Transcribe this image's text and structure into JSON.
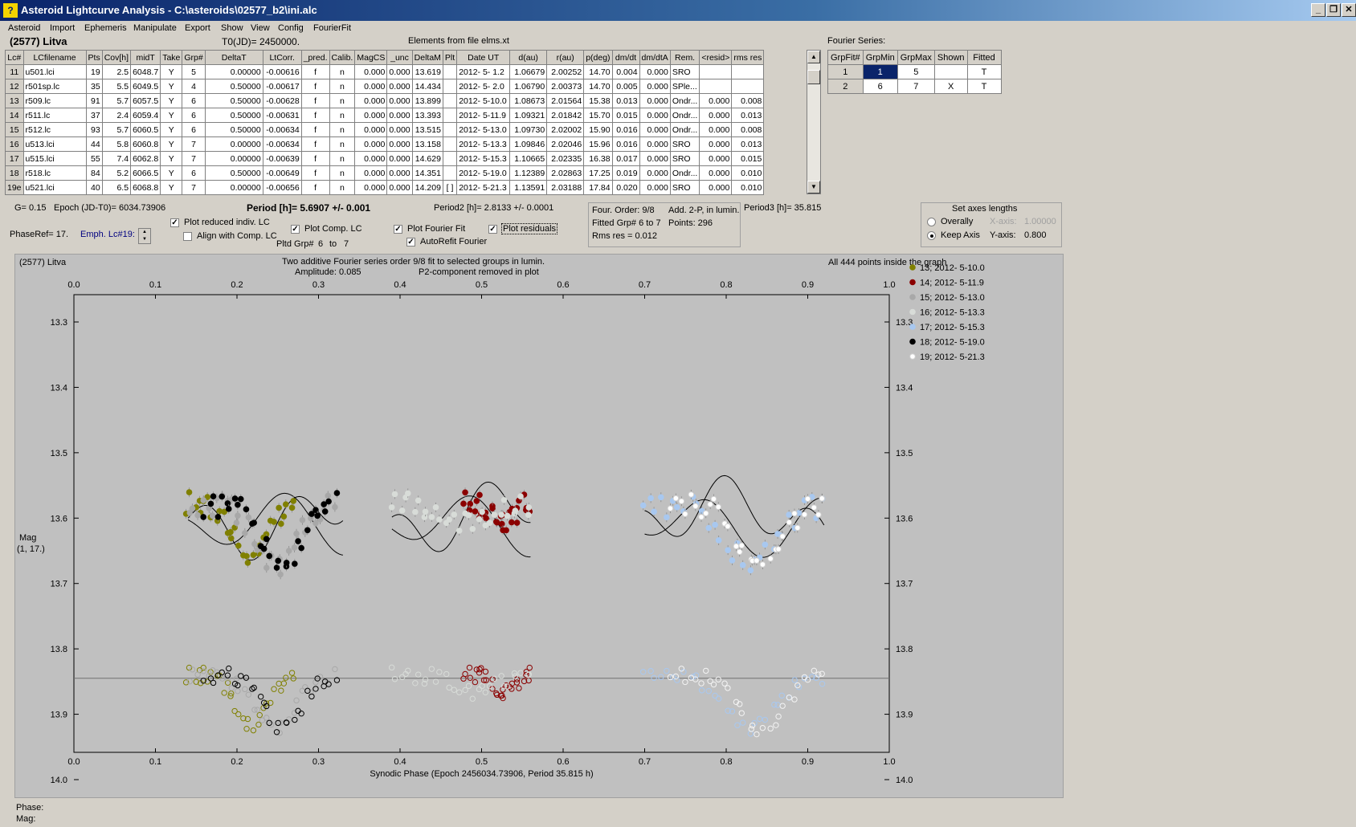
{
  "window": {
    "title": "Asteroid Lightcurve Analysis - C:\\asteroids\\02577_b2\\ini.alc",
    "app_icon": "app-icon"
  },
  "menu": [
    "Asteroid",
    "Import",
    "Ephemeris",
    "Manipulate",
    "Export",
    "Show",
    "View",
    "Config",
    "FourierFit"
  ],
  "header": {
    "asteroid": "(2577) Litva",
    "t0": "T0(JD)= 2450000.",
    "elements": "Elements from file elms.xt"
  },
  "lc_table": {
    "columns": [
      "Lc#",
      "LCfilename",
      "Pts",
      "Cov[h]",
      "midT",
      "Take",
      "Grp#",
      "DeltaT",
      "LtCorr.",
      "_pred.",
      "Calib.",
      "MagCS",
      "_unc",
      "DeltaM",
      "Plt",
      "Date UT",
      "d(au)",
      "r(au)",
      "p(deg)",
      "dm/dt",
      "dm/dtA",
      "Rem.",
      "<resid>",
      "rms res"
    ],
    "rows": [
      [
        "11",
        "u501.lci",
        "19",
        "2.5",
        "6048.7",
        "Y",
        "5",
        "0.00000",
        "-0.00616",
        "f",
        "n",
        "0.000",
        "0.000",
        "13.619",
        "",
        "2012- 5- 1.2",
        "1.06679",
        "2.00252",
        "14.70",
        "0.004",
        "0.000",
        "SRO",
        "",
        ""
      ],
      [
        "12",
        "r501sp.lc",
        "35",
        "5.5",
        "6049.5",
        "Y",
        "4",
        "0.50000",
        "-0.00617",
        "f",
        "n",
        "0.000",
        "0.000",
        "14.434",
        "",
        "2012- 5- 2.0",
        "1.06790",
        "2.00373",
        "14.70",
        "0.005",
        "0.000",
        "SPle...",
        "",
        ""
      ],
      [
        "13",
        "r509.lc",
        "91",
        "5.7",
        "6057.5",
        "Y",
        "6",
        "0.50000",
        "-0.00628",
        "f",
        "n",
        "0.000",
        "0.000",
        "13.899",
        "",
        "2012- 5-10.0",
        "1.08673",
        "2.01564",
        "15.38",
        "0.013",
        "0.000",
        "Ondr...",
        "0.000",
        "0.008"
      ],
      [
        "14",
        "r511.lc",
        "37",
        "2.4",
        "6059.4",
        "Y",
        "6",
        "0.50000",
        "-0.00631",
        "f",
        "n",
        "0.000",
        "0.000",
        "13.393",
        "",
        "2012- 5-11.9",
        "1.09321",
        "2.01842",
        "15.70",
        "0.015",
        "0.000",
        "Ondr...",
        "0.000",
        "0.013"
      ],
      [
        "15",
        "r512.lc",
        "93",
        "5.7",
        "6060.5",
        "Y",
        "6",
        "0.50000",
        "-0.00634",
        "f",
        "n",
        "0.000",
        "0.000",
        "13.515",
        "",
        "2012- 5-13.0",
        "1.09730",
        "2.02002",
        "15.90",
        "0.016",
        "0.000",
        "Ondr...",
        "0.000",
        "0.008"
      ],
      [
        "16",
        "u513.lci",
        "44",
        "5.8",
        "6060.8",
        "Y",
        "7",
        "0.00000",
        "-0.00634",
        "f",
        "n",
        "0.000",
        "0.000",
        "13.158",
        "",
        "2012- 5-13.3",
        "1.09846",
        "2.02046",
        "15.96",
        "0.016",
        "0.000",
        "SRO",
        "0.000",
        "0.013"
      ],
      [
        "17",
        "u515.lci",
        "55",
        "7.4",
        "6062.8",
        "Y",
        "7",
        "0.00000",
        "-0.00639",
        "f",
        "n",
        "0.000",
        "0.000",
        "14.629",
        "",
        "2012- 5-15.3",
        "1.10665",
        "2.02335",
        "16.38",
        "0.017",
        "0.000",
        "SRO",
        "0.000",
        "0.015"
      ],
      [
        "18",
        "r518.lc",
        "84",
        "5.2",
        "6066.5",
        "Y",
        "6",
        "0.50000",
        "-0.00649",
        "f",
        "n",
        "0.000",
        "0.000",
        "14.351",
        "",
        "2012- 5-19.0",
        "1.12389",
        "2.02863",
        "17.25",
        "0.019",
        "0.000",
        "Ondr...",
        "0.000",
        "0.010"
      ],
      [
        "19e",
        "u521.lci",
        "40",
        "6.5",
        "6068.8",
        "Y",
        "7",
        "0.00000",
        "-0.00656",
        "f",
        "n",
        "0.000",
        "0.000",
        "14.209",
        "[ ]",
        "2012- 5-21.3",
        "1.13591",
        "2.03188",
        "17.84",
        "0.020",
        "0.000",
        "SRO",
        "0.000",
        "0.010"
      ]
    ]
  },
  "fourier_series": {
    "title": "Fourier Series:",
    "columns": [
      "GrpFit#",
      "GrpMin",
      "GrpMax",
      "Shown",
      "Fitted"
    ],
    "rows": [
      [
        "1",
        "1",
        "5",
        "",
        "T"
      ],
      [
        "2",
        "6",
        "7",
        "X",
        "T"
      ]
    ]
  },
  "params": {
    "g": "G= 0.15",
    "epoch": "Epoch (JD-T0)= 6034.73906",
    "period": "Period [h]= 5.6907 +/- 0.001",
    "period2": "Period2 [h]= 2.8133 +/- 0.0001",
    "period3": "Period3 [h]= 35.815",
    "phase_ref": "PhaseRef= 17.",
    "emph": "Emph. Lc#19:",
    "plot_reduced": "Plot reduced indiv. LC",
    "align": "Align with Comp. LC",
    "plot_comp": "Plot Comp. LC",
    "pltd_grp": "Pltd Grp#",
    "pltd_from": "6",
    "pltd_to_label": "to",
    "pltd_to": "7",
    "plot_fourier": "Plot Fourier Fit",
    "autorefit": "AutoRefit Fourier",
    "plot_residuals": "Plot residuals",
    "four_order": "Four. Order:  9/8",
    "add2p": "Add. 2-P, in lumin.",
    "fitted_grp": "Fitted Grp# 6 to 7",
    "points": "Points: 296",
    "rms_res": "Rms res     = 0.012",
    "axes_title": "Set axes lengths",
    "overally": "Overally",
    "keep_axis": "Keep Axis",
    "xaxis": "X-axis:",
    "xaxis_val": "1.00000",
    "yaxis": "Y-axis:",
    "yaxis_val": "0.800"
  },
  "plot_header": {
    "asteroid": "(2577) Litva",
    "desc1": "Two additive Fourier series order 9/8 fit to selected groups in lumin.",
    "desc2": "Amplitude: 0.085",
    "desc3": "P2-component removed in plot",
    "allpts": "All 444 points inside the graph",
    "ylabel1": "Mag",
    "ylabel2": "(1, 17.)"
  },
  "status": {
    "phase": "Phase:",
    "mag": "Mag:"
  },
  "chart_data": {
    "type": "scatter",
    "xlabel": "Synodic Phase (Epoch 2456034.73906, Period 35.815 h)",
    "ylabel": "Mag",
    "xlim": [
      0.0,
      1.0
    ],
    "ylim": [
      13.3,
      14.0
    ],
    "y_reversed": true,
    "grid": false,
    "legend_position": "right",
    "xticks": [
      "0.0",
      "0.1",
      "0.2",
      "0.3",
      "0.4",
      "0.5",
      "0.6",
      "0.7",
      "0.8",
      "0.9",
      "1.0"
    ],
    "yticks": [
      "13.3",
      "13.4",
      "13.5",
      "13.6",
      "13.7",
      "13.8",
      "13.9",
      "14.0"
    ],
    "residual_baseline": 13.845,
    "series": [
      {
        "name": "13; 2012- 5-10.0",
        "color": "#808000",
        "x_range": [
          0.14,
          0.27
        ]
      },
      {
        "name": "14; 2012- 5-11.9",
        "color": "#8b0000",
        "x_range": [
          0.48,
          0.56
        ]
      },
      {
        "name": "15; 2012- 5-13.0",
        "color": "#a8a8a8",
        "x_range": [
          0.14,
          0.32
        ]
      },
      {
        "name": "16; 2012- 5-13.3",
        "color": "#d8dcd8",
        "x_range": [
          0.39,
          0.56
        ]
      },
      {
        "name": "17; 2012- 5-15.3",
        "color": "#a8c8f0",
        "x_range": [
          0.7,
          0.92
        ]
      },
      {
        "name": "18; 2012- 5-19.0",
        "color": "#000000",
        "x_range": [
          0.16,
          0.32
        ]
      },
      {
        "name": "19; 2012- 5-21.3",
        "color": "#ffffff",
        "x_range": [
          0.73,
          0.92
        ]
      }
    ]
  }
}
